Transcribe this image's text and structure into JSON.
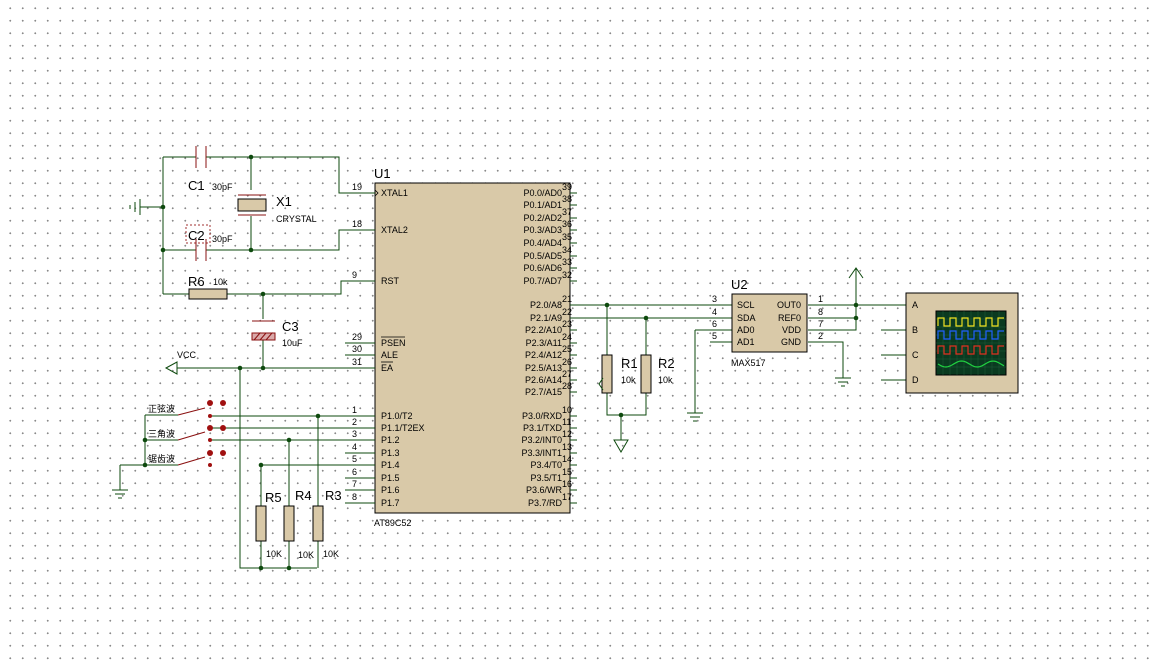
{
  "u1": {
    "ref": "U1",
    "part": "AT89C52",
    "left_pins": [
      {
        "num": "19",
        "name": "XTAL1"
      },
      {
        "num": "18",
        "name": "XTAL2"
      },
      {
        "num": "9",
        "name": "RST"
      },
      {
        "num": "29",
        "name": "PSEN"
      },
      {
        "num": "30",
        "name": "ALE"
      },
      {
        "num": "31",
        "name": "EA"
      },
      {
        "num": "1",
        "name": "P1.0/T2"
      },
      {
        "num": "2",
        "name": "P1.1/T2EX"
      },
      {
        "num": "3",
        "name": "P1.2"
      },
      {
        "num": "4",
        "name": "P1.3"
      },
      {
        "num": "5",
        "name": "P1.4"
      },
      {
        "num": "6",
        "name": "P1.5"
      },
      {
        "num": "7",
        "name": "P1.6"
      },
      {
        "num": "8",
        "name": "P1.7"
      }
    ],
    "right_pins": [
      {
        "num": "39",
        "name": "P0.0/AD0"
      },
      {
        "num": "38",
        "name": "P0.1/AD1"
      },
      {
        "num": "37",
        "name": "P0.2/AD2"
      },
      {
        "num": "36",
        "name": "P0.3/AD3"
      },
      {
        "num": "35",
        "name": "P0.4/AD4"
      },
      {
        "num": "34",
        "name": "P0.5/AD5"
      },
      {
        "num": "33",
        "name": "P0.6/AD6"
      },
      {
        "num": "32",
        "name": "P0.7/AD7"
      },
      {
        "num": "21",
        "name": "P2.0/A8"
      },
      {
        "num": "22",
        "name": "P2.1/A9"
      },
      {
        "num": "23",
        "name": "P2.2/A10"
      },
      {
        "num": "24",
        "name": "P2.3/A11"
      },
      {
        "num": "25",
        "name": "P2.4/A12"
      },
      {
        "num": "26",
        "name": "P2.5/A13"
      },
      {
        "num": "27",
        "name": "P2.6/A14"
      },
      {
        "num": "28",
        "name": "P2.7/A15"
      },
      {
        "num": "10",
        "name": "P3.0/RXD"
      },
      {
        "num": "11",
        "name": "P3.1/TXD"
      },
      {
        "num": "12",
        "name": "P3.2/INT0"
      },
      {
        "num": "13",
        "name": "P3.3/INT1"
      },
      {
        "num": "14",
        "name": "P3.4/T0"
      },
      {
        "num": "15",
        "name": "P3.5/T1"
      },
      {
        "num": "16",
        "name": "P3.6/WR"
      },
      {
        "num": "17",
        "name": "P3.7/RD"
      }
    ]
  },
  "u2": {
    "ref": "U2",
    "part": "MAX517",
    "left_pins": [
      {
        "num": "3",
        "name": "SCL"
      },
      {
        "num": "4",
        "name": "SDA"
      },
      {
        "num": "6",
        "name": "AD0"
      },
      {
        "num": "5",
        "name": "AD1"
      }
    ],
    "right_pins": [
      {
        "num": "1",
        "name": "OUT0"
      },
      {
        "num": "8",
        "name": "REF0"
      },
      {
        "num": "7",
        "name": "VDD"
      },
      {
        "num": "2",
        "name": "GND"
      }
    ]
  },
  "components": {
    "c1": {
      "ref": "C1",
      "value": "30pF"
    },
    "c2": {
      "ref": "C2",
      "value": "30pF"
    },
    "c3": {
      "ref": "C3",
      "value": "10uF"
    },
    "x1": {
      "ref": "X1",
      "value": "CRYSTAL"
    },
    "r1": {
      "ref": "R1",
      "value": "10k"
    },
    "r2": {
      "ref": "R2",
      "value": "10k"
    },
    "r3": {
      "ref": "R3",
      "value": "10K"
    },
    "r4": {
      "ref": "R4",
      "value": "10K"
    },
    "r5": {
      "ref": "R5",
      "value": "10K"
    },
    "r6": {
      "ref": "R6",
      "value": "10k"
    }
  },
  "power": {
    "vcc": "VCC"
  },
  "switches": [
    {
      "label": "正弦波"
    },
    {
      "label": "三角波"
    },
    {
      "label": "锯齿波"
    }
  ],
  "scope": {
    "channels": [
      "A",
      "B",
      "C",
      "D"
    ],
    "trace_colors": [
      "#f0e020",
      "#2060ff",
      "#e03020",
      "#20d040"
    ],
    "screen_color": "#0a3a20"
  },
  "colors": {
    "wire": "#0e4a0e",
    "component": "#8a1010",
    "body_fill": "#d9c9a8"
  }
}
